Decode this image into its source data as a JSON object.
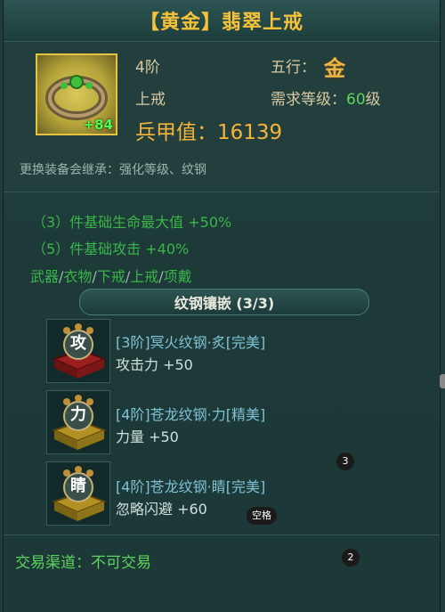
{
  "title": "【黄金】翡翠上戒",
  "item": {
    "rank": "4阶",
    "type": "上戒",
    "wuxing_label": "五行：",
    "wuxing_value": "金",
    "req_label": "需求等级：",
    "req_level": "60",
    "req_suffix": "级",
    "armor_label": "兵甲值：",
    "armor_value": "16139",
    "enhance": "+84"
  },
  "inherit_text": "更换装备会继承：强化等级、纹钢",
  "set_bonus": [
    "（3）件基础生命最大值  +50%",
    "（5）件基础攻击  +40%"
  ],
  "slots": [
    "武器",
    "衣物",
    "下戒",
    "上戒",
    "项戴"
  ],
  "slot_sep": "/",
  "section_title": "纹钢镶嵌 (3/3)",
  "gems": [
    {
      "char": "攻",
      "name": "[3阶]冥火纹钢·炙[完美]",
      "stat": "攻击力  +50",
      "color": "red"
    },
    {
      "char": "力",
      "name": "[4阶]苍龙纹钢·力[精美]",
      "stat": "力量  +50",
      "color": "gold"
    },
    {
      "char": "睛",
      "name": "[4阶]苍龙纹钢·睛[完美]",
      "stat": "忽略闪避  +60",
      "color": "gold"
    }
  ],
  "badges": {
    "b3": "3",
    "space": "空格",
    "b2": "2"
  },
  "trade": "交易渠道：不可交易",
  "colors": {
    "title": "#f5c23a",
    "green": "#5fd35f",
    "armor": "#f5b33a",
    "gem_name": "#7fc2d4"
  }
}
